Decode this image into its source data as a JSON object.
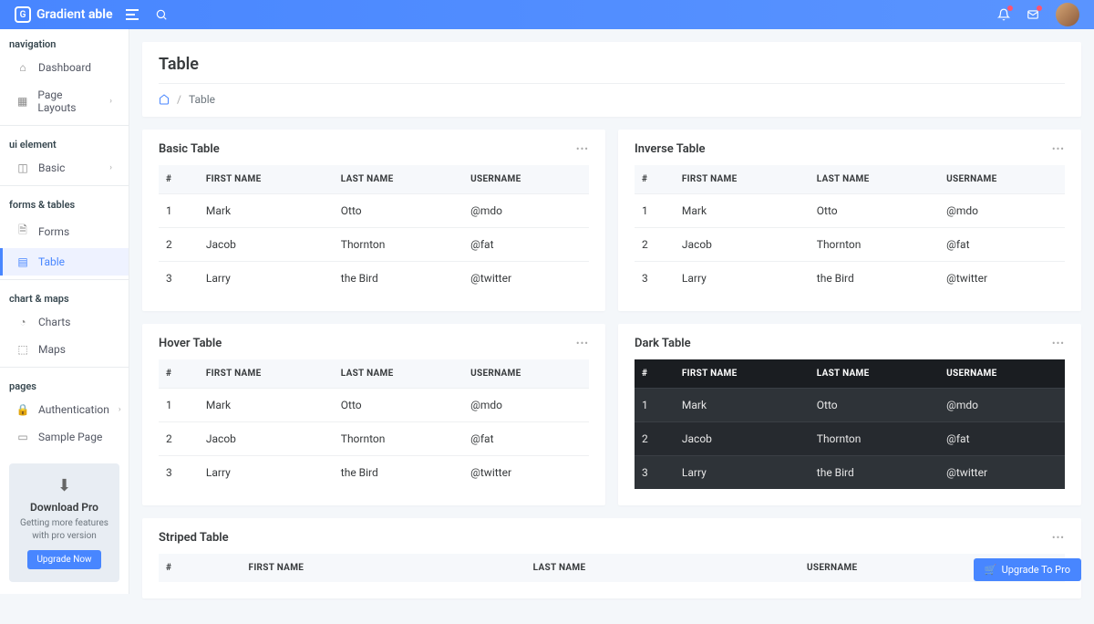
{
  "brand": {
    "name_light": "Gradient",
    "name_bold": "able"
  },
  "header": {
    "title": "Table",
    "breadcrumb_current": "Table"
  },
  "sidebar": {
    "section_navigation": "navigation",
    "section_ui": "ui element",
    "section_forms": "forms & tables",
    "section_charts": "chart & maps",
    "section_pages": "pages",
    "items": {
      "dashboard": "Dashboard",
      "page_layouts": "Page Layouts",
      "basic": "Basic",
      "forms": "Forms",
      "table": "Table",
      "charts": "Charts",
      "maps": "Maps",
      "authentication": "Authentication",
      "sample_page": "Sample Page"
    },
    "promo": {
      "title": "Download Pro",
      "desc": "Getting more features with pro version",
      "button": "Upgrade Now"
    }
  },
  "table_headers": {
    "num": "#",
    "first": "FIRST NAME",
    "last": "LAST NAME",
    "user": "USERNAME"
  },
  "table_rows": [
    {
      "n": "1",
      "first": "Mark",
      "last": "Otto",
      "user": "@mdo"
    },
    {
      "n": "2",
      "first": "Jacob",
      "last": "Thornton",
      "user": "@fat"
    },
    {
      "n": "3",
      "first": "Larry",
      "last": "the Bird",
      "user": "@twitter"
    }
  ],
  "cards": {
    "basic": "Basic Table",
    "inverse": "Inverse Table",
    "hover": "Hover Table",
    "dark": "Dark Table",
    "striped": "Striped Table"
  },
  "upgrade_float": "Upgrade To Pro"
}
